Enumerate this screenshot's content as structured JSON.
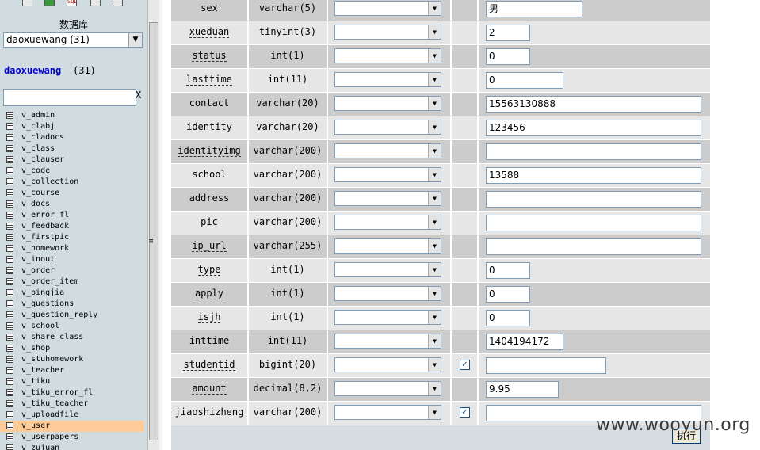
{
  "nav": {
    "db_label": "数据库",
    "db_select": "daoxuewang (31)",
    "db_name": "daoxuewang",
    "db_count": "(31)",
    "filter_clear": "X",
    "tables": [
      "v_admin",
      "v_clabj",
      "v_cladocs",
      "v_class",
      "v_clauser",
      "v_code",
      "v_collection",
      "v_course",
      "v_docs",
      "v_error_fl",
      "v_feedback",
      "v_firstpic",
      "v_homework",
      "v_inout",
      "v_order",
      "v_order_item",
      "v_pingjia",
      "v_questions",
      "v_question_reply",
      "v_school",
      "v_share_class",
      "v_shop",
      "v_stuhomework",
      "v_teacher",
      "v_tiku",
      "v_tiku_error_fl",
      "v_tiku_teacher",
      "v_uploadfile",
      "v_user",
      "v_userpapers",
      "v_zujuan"
    ],
    "selected_table": "v_user"
  },
  "fields": [
    {
      "name": "sex",
      "type": "varchar(5)",
      "null": false,
      "value": "男",
      "dotted": false
    },
    {
      "name": "xueduan",
      "type": "tinyint(3)",
      "null": false,
      "value": "2",
      "dotted": true
    },
    {
      "name": "status",
      "type": "int(1)",
      "null": false,
      "value": "0",
      "dotted": true
    },
    {
      "name": "lasttime",
      "type": "int(11)",
      "null": false,
      "value": "0",
      "dotted": true
    },
    {
      "name": "contact",
      "type": "varchar(20)",
      "null": false,
      "value": "15563130888",
      "dotted": false
    },
    {
      "name": "identity",
      "type": "varchar(20)",
      "null": false,
      "value": "123456",
      "dotted": false
    },
    {
      "name": "identityimg",
      "type": "varchar(200)",
      "null": false,
      "value": "",
      "dotted": true
    },
    {
      "name": "school",
      "type": "varchar(200)",
      "null": false,
      "value": "13588",
      "dotted": false
    },
    {
      "name": "address",
      "type": "varchar(200)",
      "null": false,
      "value": "",
      "dotted": false
    },
    {
      "name": "pic",
      "type": "varchar(200)",
      "null": false,
      "value": "",
      "dotted": false
    },
    {
      "name": "ip_url",
      "type": "varchar(255)",
      "null": false,
      "value": "",
      "dotted": true
    },
    {
      "name": "type",
      "type": "int(1)",
      "null": false,
      "value": "0",
      "dotted": true
    },
    {
      "name": "apply",
      "type": "int(1)",
      "null": false,
      "value": "0",
      "dotted": true
    },
    {
      "name": "isjh",
      "type": "int(1)",
      "null": false,
      "value": "0",
      "dotted": true
    },
    {
      "name": "inttime",
      "type": "int(11)",
      "null": false,
      "value": "1404194172",
      "dotted": false
    },
    {
      "name": "studentid",
      "type": "bigint(20)",
      "null": true,
      "value": "",
      "dotted": true
    },
    {
      "name": "amount",
      "type": "decimal(8,2)",
      "null": false,
      "value": "9.95",
      "dotted": true
    },
    {
      "name": "jiaoshizheng",
      "type": "varchar(200)",
      "null": true,
      "value": "",
      "dotted": true
    }
  ],
  "footer": {
    "execute_label": "执行"
  },
  "watermark": "www.wooyun.org",
  "colors": {
    "row_odd": "#cccccc",
    "row_even": "#e6e6e6",
    "selected_table": "#ffcc99",
    "nav_bg": "#d0dce0",
    "db_link": "#0000cc"
  }
}
